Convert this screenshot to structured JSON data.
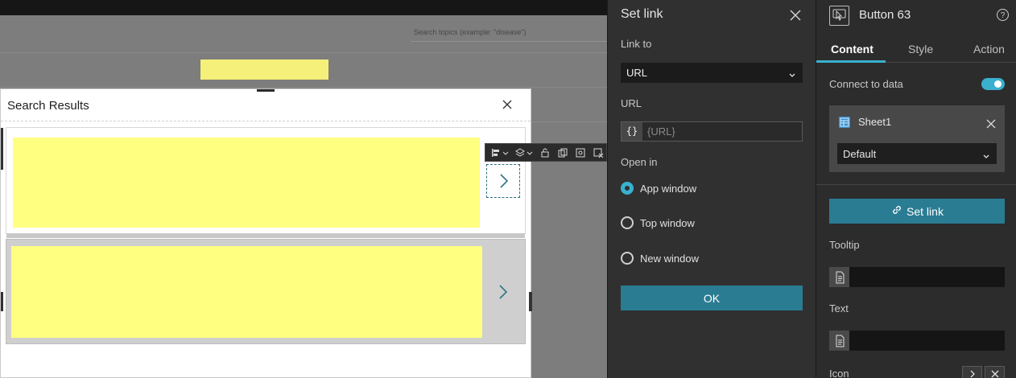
{
  "canvas": {
    "search_placeholder": "Search topics (example: \"disease\")",
    "results_panel": {
      "title": "Search Results",
      "close_icon": "close-icon"
    },
    "cards": [
      {
        "name": "result-card-1",
        "chevron": "chevron-right-icon",
        "selected": true
      },
      {
        "name": "result-card-2",
        "chevron": "chevron-right-icon",
        "selected": false
      }
    ],
    "toolbar_icons": [
      "align-icon",
      "layers-icon",
      "lock-icon",
      "duplicate-icon",
      "screenshot-icon",
      "remove-icon"
    ]
  },
  "set_link_panel": {
    "title": "Set link",
    "link_to_label": "Link to",
    "link_to_value": "URL",
    "url_label": "URL",
    "url_icon": "{}",
    "url_placeholder": "{URL}",
    "open_in_label": "Open in",
    "options": [
      {
        "label": "App window",
        "checked": true
      },
      {
        "label": "Top window",
        "checked": false
      },
      {
        "label": "New window",
        "checked": false
      }
    ],
    "ok_label": "OK"
  },
  "properties": {
    "widget_title": "Button 63",
    "tabs": [
      "Content",
      "Style",
      "Action"
    ],
    "active_tab": "Content",
    "connect_label": "Connect to data",
    "connect_on": true,
    "data_source": "Sheet1",
    "data_view": "Default",
    "set_link_button": "Set link",
    "tooltip_label": "Tooltip",
    "text_label": "Text",
    "icon_label": "Icon"
  },
  "colors": {
    "accent": "#3ab0cf",
    "button": "#2a7c93",
    "yellow": "#ffff80"
  }
}
